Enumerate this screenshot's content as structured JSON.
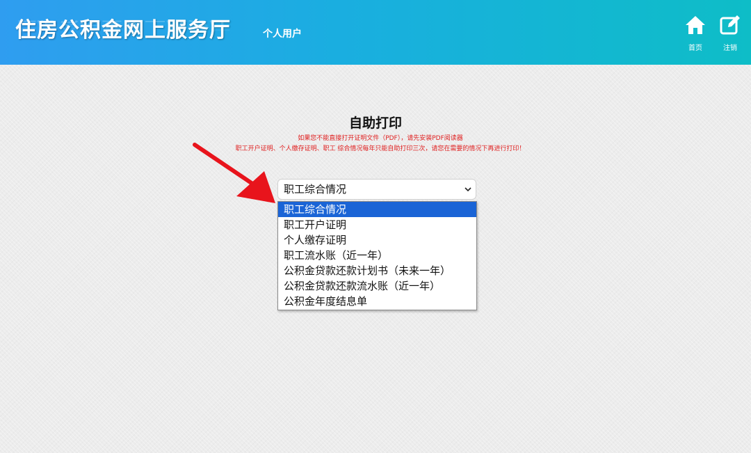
{
  "header": {
    "site_title": "住房公积金网上服务厅",
    "user_type": "个人用户",
    "nav": [
      {
        "label": "首页",
        "icon": "home-icon"
      },
      {
        "label": "注销",
        "icon": "edit-icon"
      }
    ]
  },
  "main": {
    "title": "自助打印",
    "notice_lines": [
      "如果您不能直接打开证明文件（PDF），请先安装PDF阅读器",
      "职工开户证明、个人缴存证明、职工 综合情况每年只能自助打印三次，请您在需要的情况下再进行打印！"
    ],
    "select": {
      "value": "职工综合情况",
      "options": [
        "职工综合情况",
        "职工开户证明",
        "个人缴存证明",
        "职工流水账（近一年）",
        "公积金贷款还款计划书（未来一年）",
        "公积金贷款还款流水账（近一年）",
        "公积金年度结息单"
      ],
      "highlighted_index": 0
    }
  },
  "colors": {
    "header_start": "#2f9df0",
    "header_end": "#0ebdc7",
    "notice_red": "#e02020",
    "highlight_blue": "#1a64d6",
    "arrow_red": "#e8141c"
  }
}
